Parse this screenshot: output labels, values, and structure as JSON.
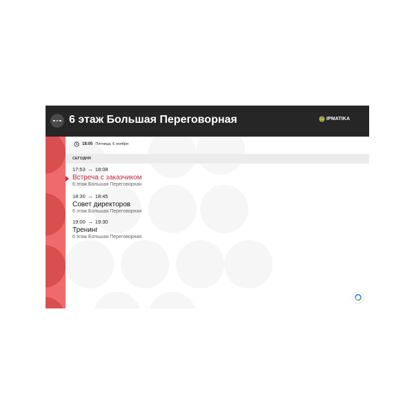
{
  "header": {
    "title": "6 этаж Большая Переговорная",
    "menu_icon": "more-horizontal-icon",
    "logo_text": "IPMATIKA",
    "logo_icon": "globe-icon"
  },
  "clock": {
    "icon": "clock-icon",
    "time": "18:05",
    "date": "Пятница, 6 ноября"
  },
  "section": {
    "today_label": "СЕГОДНЯ"
  },
  "events": [
    {
      "start": "17:53",
      "end": "18:08",
      "title": "Встреча с заказчиком",
      "room": "6 этаж Большая Переговорная",
      "active": true
    },
    {
      "start": "18:30",
      "end": "18:45",
      "title": "Совет директоров",
      "room": "6 этаж Большая Переговорная",
      "active": false
    },
    {
      "start": "19:00",
      "end": "19:30",
      "title": "Тренинг",
      "room": "6 этаж Большая Переговорная",
      "active": false
    }
  ],
  "arrow": "→",
  "colors": {
    "header_bg": "#262626",
    "sidebar": "#ef6b6b",
    "accent": "#c8283f"
  }
}
